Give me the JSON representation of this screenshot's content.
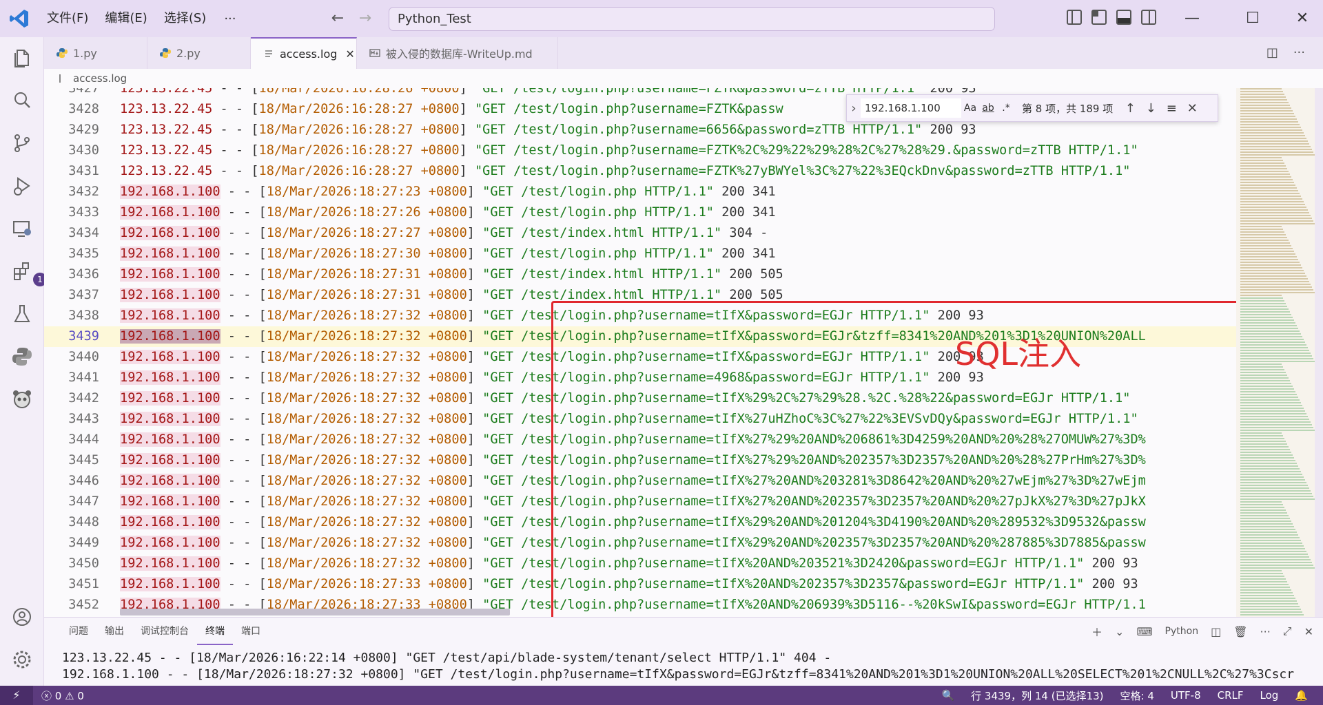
{
  "menu": {
    "file": "文件(F)",
    "edit": "编辑(E)",
    "select": "选择(S)",
    "more": "···"
  },
  "search_value": "Python_Test",
  "tabs": [
    {
      "label": "1.py"
    },
    {
      "label": "2.py"
    },
    {
      "label": "access.log"
    },
    {
      "label": "被入侵的数据库-WriteUp.md"
    }
  ],
  "breadcrumb": "access.log",
  "find": {
    "value": "192.168.1.100",
    "case_label": "Aa",
    "word_label": "ab",
    "regex_label": ".*",
    "count": "第 8 项，共 189 项"
  },
  "annotation": "SQL注入",
  "lines": [
    {
      "n": "3428",
      "ip": "123.13.22.45",
      "dt": "18/Mar/2026:16:28:27 +0800",
      "req": "\"GET /test/login.php?username=FZTK&passw",
      "tail": ""
    },
    {
      "n": "3429",
      "ip": "123.13.22.45",
      "dt": "18/Mar/2026:16:28:27 +0800",
      "req": "\"GET /test/login.php?username=6656&password=zTTB HTTP/1.1\"",
      "tail": " 200 93"
    },
    {
      "n": "3430",
      "ip": "123.13.22.45",
      "dt": "18/Mar/2026:16:28:27 +0800",
      "req": "\"GET /test/login.php?username=FZTK%2C%29%22%29%28%2C%27%28%29.&password=zTTB HTTP/1.1\"",
      "tail": ""
    },
    {
      "n": "3431",
      "ip": "123.13.22.45",
      "dt": "18/Mar/2026:16:28:27 +0800",
      "req": "\"GET /test/login.php?username=FZTK%27yBWYel%3C%27%22%3EQckDnv&password=zTTB HTTP/1.1\"",
      "tail": ""
    },
    {
      "n": "3432",
      "ip": "192.168.1.100",
      "dt": "18/Mar/2026:18:27:23 +0800",
      "req": "\"GET /test/login.php HTTP/1.1\"",
      "tail": " 200 341"
    },
    {
      "n": "3433",
      "ip": "192.168.1.100",
      "dt": "18/Mar/2026:18:27:26 +0800",
      "req": "\"GET /test/login.php HTTP/1.1\"",
      "tail": " 200 341"
    },
    {
      "n": "3434",
      "ip": "192.168.1.100",
      "dt": "18/Mar/2026:18:27:27 +0800",
      "req": "\"GET /test/index.html HTTP/1.1\"",
      "tail": " 304 -"
    },
    {
      "n": "3435",
      "ip": "192.168.1.100",
      "dt": "18/Mar/2026:18:27:30 +0800",
      "req": "\"GET /test/login.php HTTP/1.1\"",
      "tail": " 200 341"
    },
    {
      "n": "3436",
      "ip": "192.168.1.100",
      "dt": "18/Mar/2026:18:27:31 +0800",
      "req": "\"GET /test/index.html HTTP/1.1\"",
      "tail": " 200 505"
    },
    {
      "n": "3437",
      "ip": "192.168.1.100",
      "dt": "18/Mar/2026:18:27:31 +0800",
      "req": "\"GET /test/index.html HTTP/1.1\"",
      "tail": " 200 505"
    },
    {
      "n": "3438",
      "ip": "192.168.1.100",
      "dt": "18/Mar/2026:18:27:32 +0800",
      "req": "\"GET /test/login.php?username=tIfX&password=EGJr HTTP/1.1\"",
      "tail": " 200 93"
    },
    {
      "n": "3439",
      "ip": "192.168.1.100",
      "dt": "18/Mar/2026:18:27:32 +0800",
      "req": "\"GET /test/login.php?username=tIfX&password=EGJr&tzff=8341%20AND%201%3D1%20UNION%20ALL",
      "tail": ""
    },
    {
      "n": "3440",
      "ip": "192.168.1.100",
      "dt": "18/Mar/2026:18:27:32 +0800",
      "req": "\"GET /test/login.php?username=tIfX&password=EGJr HTTP/1.1\"",
      "tail": " 200 93"
    },
    {
      "n": "3441",
      "ip": "192.168.1.100",
      "dt": "18/Mar/2026:18:27:32 +0800",
      "req": "\"GET /test/login.php?username=4968&password=EGJr HTTP/1.1\"",
      "tail": " 200 93"
    },
    {
      "n": "3442",
      "ip": "192.168.1.100",
      "dt": "18/Mar/2026:18:27:32 +0800",
      "req": "\"GET /test/login.php?username=tIfX%29%2C%27%29%28.%2C.%28%22&password=EGJr HTTP/1.1\"",
      "tail": ""
    },
    {
      "n": "3443",
      "ip": "192.168.1.100",
      "dt": "18/Mar/2026:18:27:32 +0800",
      "req": "\"GET /test/login.php?username=tIfX%27uHZhoC%3C%27%22%3EVSvDQy&password=EGJr HTTP/1.1\"",
      "tail": ""
    },
    {
      "n": "3444",
      "ip": "192.168.1.100",
      "dt": "18/Mar/2026:18:27:32 +0800",
      "req": "\"GET /test/login.php?username=tIfX%27%29%20AND%206861%3D4259%20AND%20%28%27OMUW%27%3D%",
      "tail": ""
    },
    {
      "n": "3445",
      "ip": "192.168.1.100",
      "dt": "18/Mar/2026:18:27:32 +0800",
      "req": "\"GET /test/login.php?username=tIfX%27%29%20AND%202357%3D2357%20AND%20%28%27PrHm%27%3D%",
      "tail": ""
    },
    {
      "n": "3446",
      "ip": "192.168.1.100",
      "dt": "18/Mar/2026:18:27:32 +0800",
      "req": "\"GET /test/login.php?username=tIfX%27%20AND%203281%3D8642%20AND%20%27wEjm%27%3D%27wEjm",
      "tail": ""
    },
    {
      "n": "3447",
      "ip": "192.168.1.100",
      "dt": "18/Mar/2026:18:27:32 +0800",
      "req": "\"GET /test/login.php?username=tIfX%27%20AND%202357%3D2357%20AND%20%27pJkX%27%3D%27pJkX",
      "tail": ""
    },
    {
      "n": "3448",
      "ip": "192.168.1.100",
      "dt": "18/Mar/2026:18:27:32 +0800",
      "req": "\"GET /test/login.php?username=tIfX%29%20AND%201204%3D4190%20AND%20%289532%3D9532&passw",
      "tail": ""
    },
    {
      "n": "3449",
      "ip": "192.168.1.100",
      "dt": "18/Mar/2026:18:27:32 +0800",
      "req": "\"GET /test/login.php?username=tIfX%29%20AND%202357%3D2357%20AND%20%287885%3D7885&passw",
      "tail": ""
    },
    {
      "n": "3450",
      "ip": "192.168.1.100",
      "dt": "18/Mar/2026:18:27:32 +0800",
      "req": "\"GET /test/login.php?username=tIfX%20AND%203521%3D2420&password=EGJr HTTP/1.1\"",
      "tail": " 200 93"
    },
    {
      "n": "3451",
      "ip": "192.168.1.100",
      "dt": "18/Mar/2026:18:27:33 +0800",
      "req": "\"GET /test/login.php?username=tIfX%20AND%202357%3D2357&password=EGJr HTTP/1.1\"",
      "tail": " 200 93"
    },
    {
      "n": "3452",
      "ip": "192.168.1.100",
      "dt": "18/Mar/2026:18:27:33 +0800",
      "req": "\"GET /test/login.php?username=tIfX%20AND%206939%3D5116--%20kSwI&password=EGJr HTTP/1.1",
      "tail": ""
    }
  ],
  "panel": {
    "tabs": [
      "问题",
      "输出",
      "调试控制台",
      "终端",
      "端口"
    ],
    "shell": "Python",
    "terminal": [
      "123.13.22.45 - - [18/Mar/2026:16:22:14 +0800] \"GET /test/api/blade-system/tenant/select HTTP/1.1\" 404 -",
      "192.168.1.100 - - [18/Mar/2026:18:27:32 +0800] \"GET /test/login.php?username=tIfX&password=EGJr&tzff=8341%20AND%201%3D1%20UNION%20ALL%20SELECT%201%2CNULL%2C%27%3Cscr"
    ]
  },
  "status": {
    "errors": "0",
    "warnings": "0",
    "position": "行 3439，列 14 (已选择13)",
    "spaces": "空格: 4",
    "encoding": "UTF-8",
    "eol": "CRLF",
    "language": "Log"
  },
  "colors": {
    "accent": "#5c3b7e",
    "annotation": "#e0282e",
    "ip_highlight": "#f5dce6"
  }
}
